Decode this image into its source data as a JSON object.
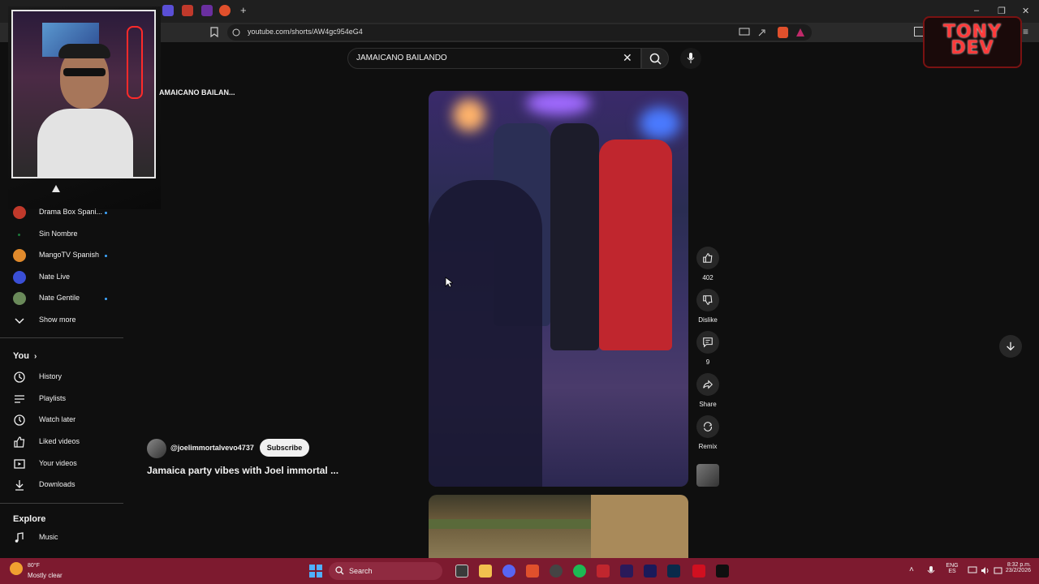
{
  "browser": {
    "url": "youtube.com/shorts/AW4gc954eG4"
  },
  "logo": {
    "text": "TONY\nDEV"
  },
  "search": {
    "query": "JAMAICANO BAILANDO"
  },
  "breadcrumb": "AMAICANO BAILAN...",
  "sidebar": {
    "subscriptions": [
      {
        "label": "Drama Box Spani...",
        "color": "#c0392b",
        "dot": true
      },
      {
        "label": "Sin Nombre",
        "color": "#1b7a3a",
        "dot": false
      },
      {
        "label": "MangoTV Spanish",
        "color": "#e08a2c",
        "dot": true
      },
      {
        "label": "Nate Live",
        "color": "#3a4fd6",
        "dot": false
      },
      {
        "label": "Nate Gentile",
        "color": "#6a8a5a",
        "dot": true
      }
    ],
    "show_more": "Show more",
    "you_title": "You",
    "you_items": [
      {
        "label": "History",
        "icon": "history-icon"
      },
      {
        "label": "Playlists",
        "icon": "playlists-icon"
      },
      {
        "label": "Watch later",
        "icon": "watch-later-icon"
      },
      {
        "label": "Liked videos",
        "icon": "liked-icon"
      },
      {
        "label": "Your videos",
        "icon": "your-videos-icon"
      },
      {
        "label": "Downloads",
        "icon": "downloads-icon"
      }
    ],
    "explore_title": "Explore",
    "explore_items": [
      {
        "label": "Music",
        "icon": "music-icon"
      }
    ]
  },
  "video": {
    "channel_handle": "@joelimmortalvevo4737",
    "subscribe_label": "Subscribe",
    "title": "Jamaica party vibes with Joel immortal ..."
  },
  "actions": {
    "likes": "402",
    "dislike_label": "Dislike",
    "comments": "9",
    "share_label": "Share",
    "remix_label": "Remix"
  },
  "taskbar": {
    "weather_temp": "80°F",
    "weather_desc": "Mostly clear",
    "search_label": "Search",
    "lang_1": "ENG",
    "lang_2": "ES",
    "time": "8:32 p.m.",
    "date": "23/2/2026"
  },
  "colors": {
    "background": "#0f0f0f",
    "taskbar": "#7d1a2f",
    "subscribe_bg": "#f1f1f1",
    "accent_dot": "#3ea6ff"
  }
}
